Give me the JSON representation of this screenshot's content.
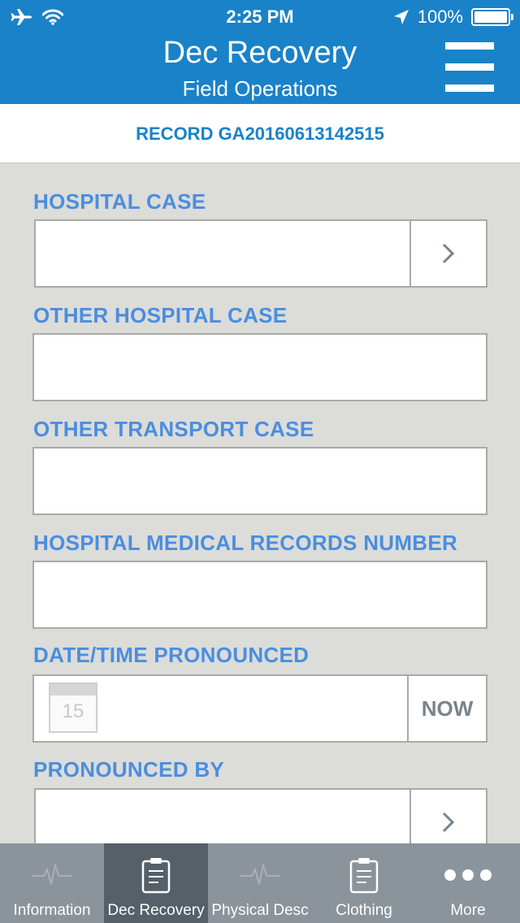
{
  "status_bar": {
    "time": "2:25 PM",
    "battery": "100%"
  },
  "header": {
    "title": "Dec Recovery",
    "subtitle": "Field Operations"
  },
  "record": {
    "label": "RECORD GA20160613142515"
  },
  "form": {
    "hospital_case": {
      "label": "HOSPITAL CASE",
      "value": ""
    },
    "other_hospital_case": {
      "label": "OTHER HOSPITAL CASE",
      "value": ""
    },
    "other_transport_case": {
      "label": "OTHER TRANSPORT CASE",
      "value": ""
    },
    "hospital_medical_records_number": {
      "label": "HOSPITAL MEDICAL RECORDS NUMBER",
      "value": ""
    },
    "datetime_pronounced": {
      "label": "DATE/TIME PRONOUNCED",
      "value": "",
      "calendar_day": "15",
      "now_label": "NOW"
    },
    "pronounced_by": {
      "label": "PRONOUNCED BY",
      "value": ""
    }
  },
  "tabs": [
    {
      "label": "Information",
      "icon": "pulse-icon",
      "active": false
    },
    {
      "label": "Dec Recovery",
      "icon": "clipboard-icon",
      "active": true
    },
    {
      "label": "Physical Desc",
      "icon": "pulse-icon",
      "active": false
    },
    {
      "label": "Clothing",
      "icon": "clipboard-icon",
      "active": false
    },
    {
      "label": "More",
      "icon": "more-dots-icon",
      "active": false
    }
  ],
  "colors": {
    "header_blue": "#1a82c8",
    "label_blue": "#4a8ee0",
    "tabbar": "#8b949b",
    "tab_active": "#556068"
  }
}
